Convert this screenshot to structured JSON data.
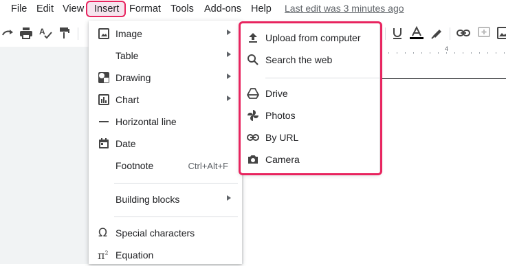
{
  "menubar": {
    "items": [
      "File",
      "Edit",
      "View",
      "Insert",
      "Format",
      "Tools",
      "Add-ons",
      "Help"
    ],
    "last_edit": "Last edit was 3 minutes ago"
  },
  "ruler": {
    "tick_label": "4"
  },
  "insert_menu": {
    "items": [
      {
        "label": "Image",
        "icon": "image-icon",
        "submenu": true
      },
      {
        "label": "Table",
        "icon": "",
        "submenu": true
      },
      {
        "label": "Drawing",
        "icon": "drawing-icon",
        "submenu": true
      },
      {
        "label": "Chart",
        "icon": "chart-icon",
        "submenu": true
      },
      {
        "label": "Horizontal line",
        "icon": "horizontal-line-icon",
        "submenu": false
      },
      {
        "label": "Date",
        "icon": "calendar-icon",
        "submenu": false
      },
      {
        "label": "Footnote",
        "icon": "",
        "submenu": false,
        "shortcut": "Ctrl+Alt+F"
      },
      {
        "label": "Building blocks",
        "icon": "",
        "submenu": true
      },
      {
        "label": "Special characters",
        "icon": "omega-icon",
        "submenu": false
      },
      {
        "label": "Equation",
        "icon": "pi-icon",
        "submenu": false
      }
    ]
  },
  "image_submenu": {
    "items": [
      {
        "label": "Upload from computer",
        "icon": "upload-icon"
      },
      {
        "label": "Search the web",
        "icon": "search-icon"
      },
      {
        "label": "Drive",
        "icon": "drive-icon"
      },
      {
        "label": "Photos",
        "icon": "photos-icon"
      },
      {
        "label": "By URL",
        "icon": "link-icon"
      },
      {
        "label": "Camera",
        "icon": "camera-icon"
      }
    ]
  },
  "colors": {
    "highlight": "#e8245f",
    "text_color_underline": "#000000"
  }
}
